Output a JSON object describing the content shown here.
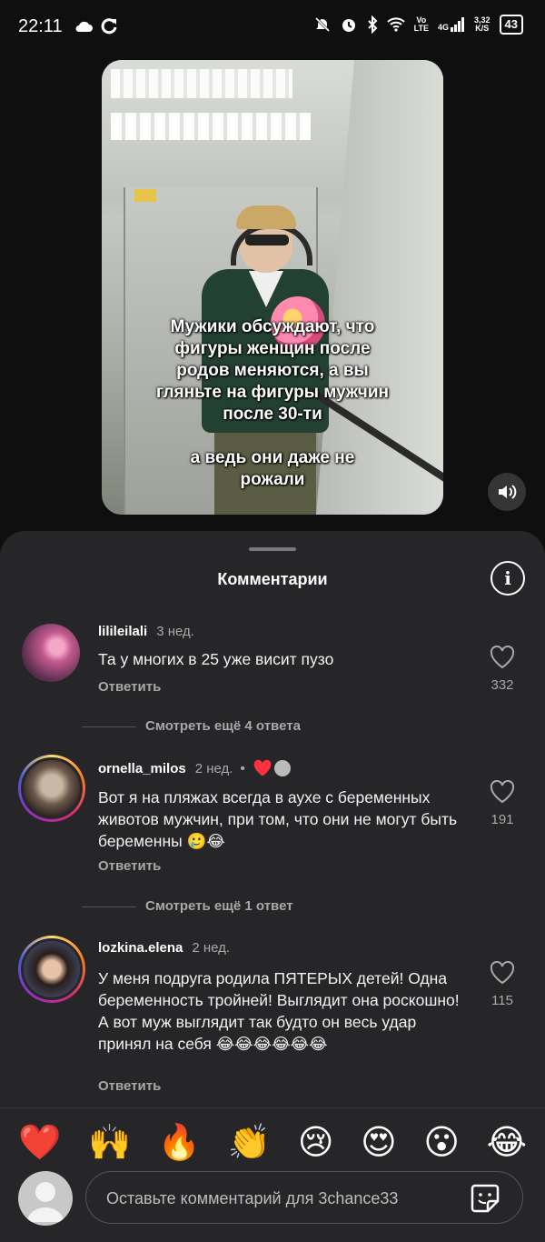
{
  "status_bar": {
    "time": "22:11",
    "lte_top": "Vo",
    "lte_bottom": "LTE",
    "network": "4G",
    "speed_top": "3,32",
    "speed_bottom": "K/S",
    "battery": "43"
  },
  "video": {
    "caption_line1": "Мужики обсуждают, что фигуры женщин после родов меняются, а вы гляньте на фигуры мужчин после 30-ти",
    "caption_line2": "а ведь они даже не рожали"
  },
  "sheet": {
    "title": "Комментарии"
  },
  "comments": [
    {
      "username": "lilileilali",
      "time": "3 нед.",
      "text": "Та у многих в 25 уже висит пузо",
      "reply_label": "Ответить",
      "likes": "332",
      "see_more": "Смотреть ещё 4 ответа"
    },
    {
      "username": "ornella_milos",
      "time": "2 нед.",
      "text": "Вот я на пляжах всегда в аухе с беременных животов мужчин, при том, что они не могут быть беременны 🥲😂",
      "reply_label": "Ответить",
      "likes": "191",
      "see_more": "Смотреть ещё 1 ответ"
    },
    {
      "username": "lozkina.elena",
      "time": "2 нед.",
      "text": "У меня подруга родила ПЯТЕРЫХ детей! Одна беременность тройней! Выглядит она роскошно! А вот муж выглядит так будто он весь удар принял на себя 😂😂😂😂😂😂",
      "reply_label": "Ответить",
      "likes": "115"
    }
  ],
  "emoji_bar": [
    "❤️",
    "🙌",
    "🔥",
    "👏",
    "😢",
    "😍",
    "😮",
    "😂"
  ],
  "composer": {
    "placeholder": "Оставьте комментарий для 3chance33"
  },
  "colors": {
    "sheet_bg": "#262628",
    "page_bg": "#0f0f10",
    "muted_text": "#a8a8a8",
    "heart_red": "#ff3040"
  },
  "icons": [
    "cloud-icon",
    "sync-icon",
    "mute-icon",
    "alarm-icon",
    "bluetooth-icon",
    "wifi-icon",
    "signal-icon",
    "battery-icon",
    "speaker-icon",
    "info-icon",
    "heart-icon",
    "sticker-icon"
  ]
}
